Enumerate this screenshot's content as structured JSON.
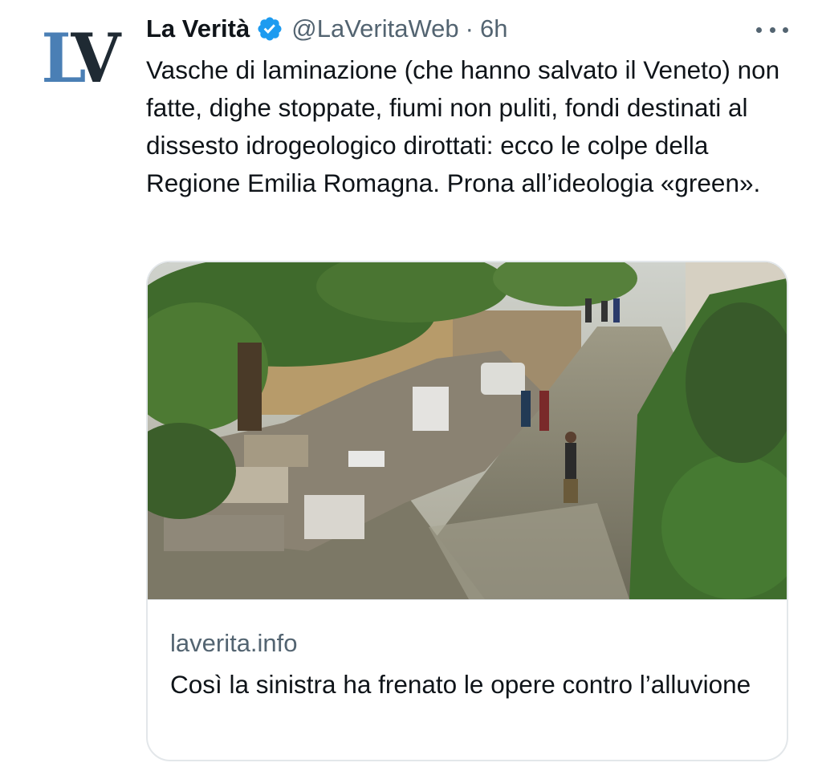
{
  "tweet": {
    "author": {
      "display_name": "La Verità",
      "verified": true,
      "handle": "@LaVeritaWeb",
      "separator": "·",
      "time": "6h",
      "avatar_text_l": "L",
      "avatar_text_v": "V"
    },
    "text": "Vasche di laminazione (che hanno salvato il Veneto) non fatte, dighe stoppate, fiumi non puliti, fondi destinati al dissesto idrogeologico dirottati: ecco le colpe della Regione Emilia Romagna. Prona all’ideologia «green».",
    "more_icon": "more-horizontal-icon",
    "card": {
      "image_icon": "flooded-street-photo",
      "domain": "laverita.info",
      "title": "Così la sinistra ha frenato le opere contro l’alluvione"
    }
  },
  "colors": {
    "text_primary": "#0f1419",
    "text_secondary": "#536471",
    "verified_blue": "#1d9bf0",
    "border": "#e3e7ea",
    "logo_blue": "#4a7fb5",
    "logo_dark": "#1f2a33"
  }
}
